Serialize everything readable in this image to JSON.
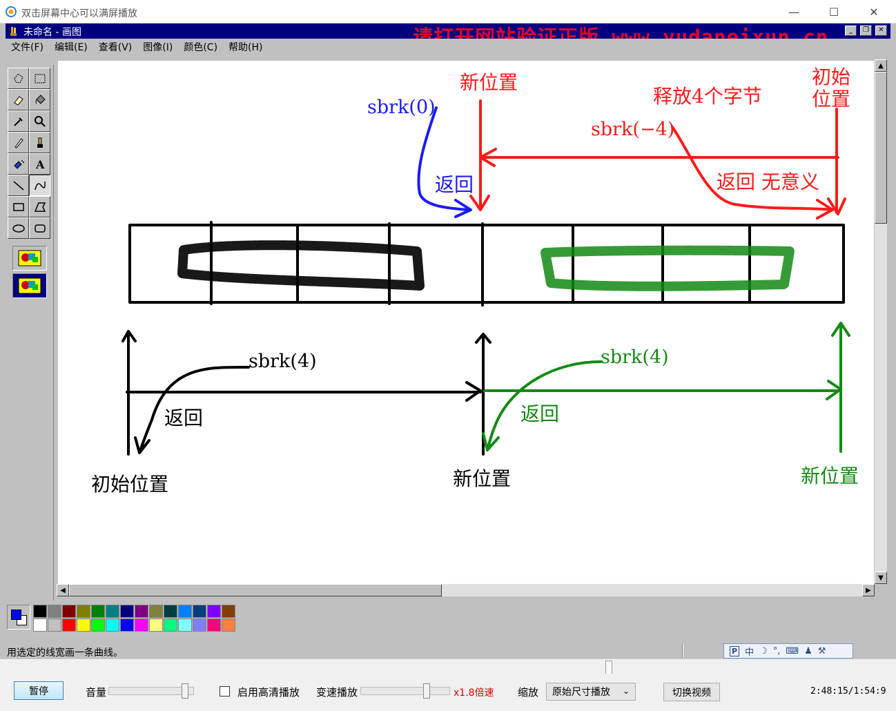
{
  "player": {
    "title": "双击屏幕中心可以满屏播放",
    "controls": {
      "pause": "暂停",
      "volume": "音量",
      "hd_checkbox": "启用高清播放",
      "variable_speed": "变速播放",
      "speed_value": "x1.8倍速",
      "zoom": "缩放",
      "zoom_option": "原始尺寸播放",
      "switch_video": "切换视频",
      "time": "2:48:15/1:54:9"
    },
    "volume_level": 0.92,
    "speed_level": 0.75,
    "progress": 0.68
  },
  "paint": {
    "title": "未命名 - 画图",
    "watermark": "请打开网站验证正版 www.yudaneixun.cn",
    "menu": [
      "文件(F)",
      "编辑(E)",
      "查看(V)",
      "图像(I)",
      "颜色(C)",
      "帮助(H)"
    ],
    "status": "用选定的线宽画一条曲线。",
    "fg_color": "#0000ff",
    "palette_row1": [
      "#000000",
      "#808080",
      "#800000",
      "#808000",
      "#008000",
      "#008080",
      "#000080",
      "#800080",
      "#808040",
      "#004040",
      "#0080ff",
      "#004080",
      "#8000ff",
      "#804000"
    ],
    "palette_row2": [
      "#ffffff",
      "#c0c0c0",
      "#ff0000",
      "#ffff00",
      "#00ff00",
      "#00ffff",
      "#0000ff",
      "#ff00ff",
      "#ffff80",
      "#00ff80",
      "#80ffff",
      "#8080ff",
      "#ff0080",
      "#ff8040"
    ],
    "ime": [
      "中"
    ]
  },
  "drawing": {
    "top": {
      "new_pos": "新位置",
      "release": "释放4个字节",
      "init_pos": "初始位置",
      "sbrk0": "sbrk(0)",
      "sbrk_neg4": "sbrk(−4)",
      "return_blue": "返回",
      "return_red": "返回 无意义"
    },
    "bottom": {
      "sbrk4_black": "sbrk(4)",
      "return_black": "返回",
      "init_pos": "初始位置",
      "new_pos_mid": "新位置",
      "sbrk4_green": "sbrk(4)",
      "return_green": "返回",
      "new_pos_right": "新位置"
    },
    "colors": {
      "red": "#ff1a1a",
      "blue": "#1a1aff",
      "green": "#138a13",
      "black": "#000000"
    }
  }
}
